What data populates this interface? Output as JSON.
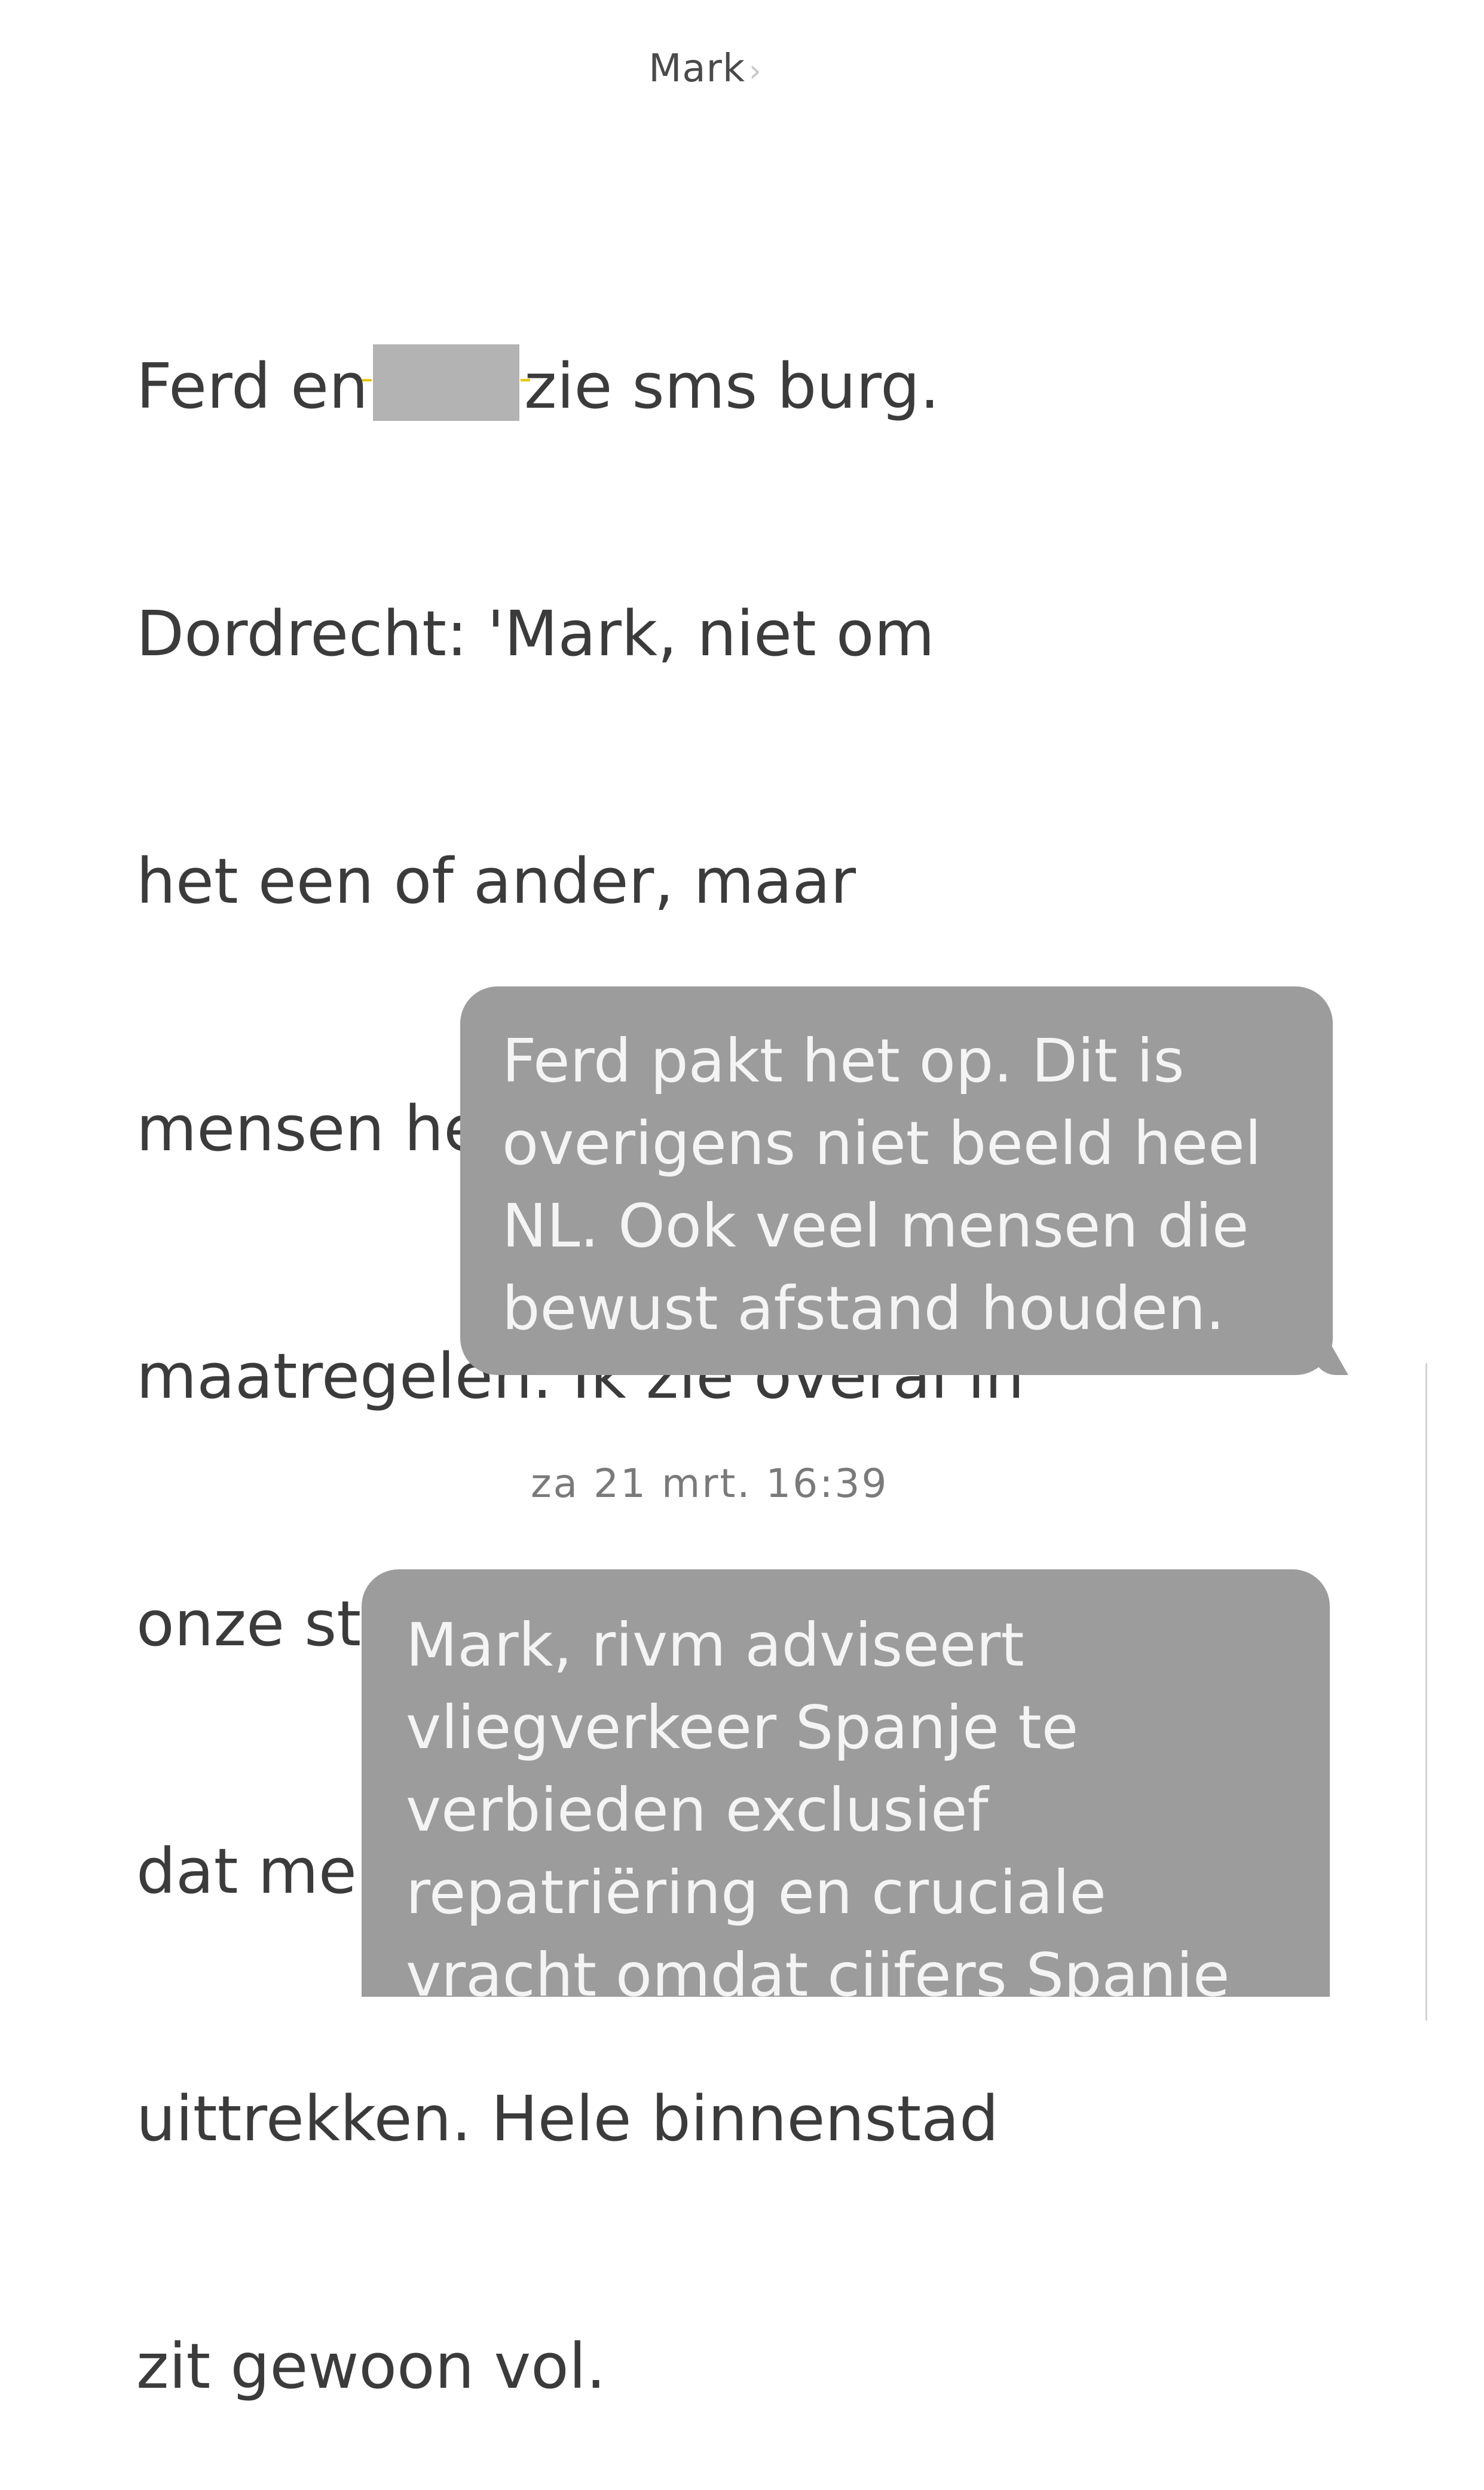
{
  "header": {
    "contact_name": "Mark",
    "chevron": "›"
  },
  "received_message": {
    "lines": [
      "Ferd en",
      "zie sms burg.",
      "Dordrecht: 'Mark, niet om",
      "het een of ander, maar",
      "mensen hebben lak aan de",
      "maatregelen. Ik zie overal in",
      "onze stad en ook in de regio",
      "dat mensen er gezellig op",
      "uittrekken. Hele binnenstad",
      "zit gewoon vol."
    ]
  },
  "sent_message_1": {
    "lines": [
      "Ferd pakt het op. Dit is",
      "overigens niet beeld heel",
      "NL. Ook veel mensen die",
      "bewust afstand houden."
    ]
  },
  "timestamp": "za 21 mrt. 16:39",
  "sent_message_2": {
    "lines": [
      "Mark, rivm adviseert",
      "vliegverkeer Spanje te",
      "verbieden exclusief",
      "repatriëring en cruciale",
      "vracht omdat cijfers Spanje"
    ]
  },
  "colors": {
    "bubble": "#9c9c9c",
    "redaction": "#b3b3b3",
    "highlight_marker": "#e8c400"
  }
}
